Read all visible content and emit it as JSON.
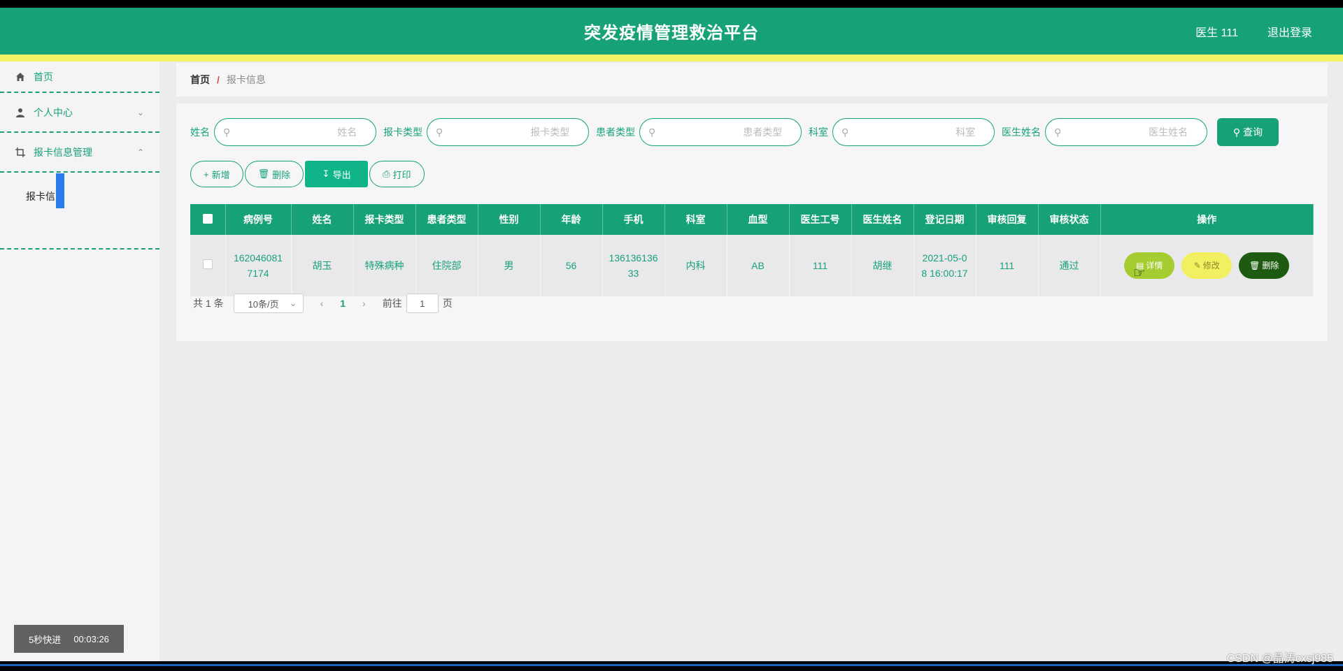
{
  "header": {
    "title": "突发疫情管理救治平台",
    "user": "医生 111",
    "logout": "退出登录"
  },
  "sidebar": {
    "items": [
      {
        "label": "首页",
        "icon": "home-icon"
      },
      {
        "label": "个人中心",
        "icon": "user-icon"
      },
      {
        "label": "报卡信息管理",
        "icon": "crop-icon"
      }
    ],
    "sub_item": "报卡信息"
  },
  "breadcrumb": {
    "home": "首页",
    "sep": "/",
    "current": "报卡信息"
  },
  "search": {
    "fields": [
      {
        "label": "姓名",
        "placeholder": "姓名"
      },
      {
        "label": "报卡类型",
        "placeholder": "报卡类型"
      },
      {
        "label": "患者类型",
        "placeholder": "患者类型"
      },
      {
        "label": "科室",
        "placeholder": "科室"
      },
      {
        "label": "医生姓名",
        "placeholder": "医生姓名"
      }
    ],
    "query_label": "查询"
  },
  "actions": {
    "add": "新增",
    "delete": "删除",
    "export": "导出",
    "print": "打印"
  },
  "table": {
    "headers": [
      "病例号",
      "姓名",
      "报卡类型",
      "患者类型",
      "性别",
      "年龄",
      "手机",
      "科室",
      "血型",
      "医生工号",
      "医生姓名",
      "登记日期",
      "审核回复",
      "审核状态",
      "操作"
    ],
    "rows": [
      {
        "case_no": "1620460817174",
        "name": "胡玉",
        "card_type": "特殊病种",
        "patient_type": "住院部",
        "gender": "男",
        "age": "56",
        "phone": "13613613633",
        "dept": "内科",
        "blood": "AB",
        "doctor_id": "111",
        "doctor_name": "胡继",
        "date": "2021-05-08 16:00:17",
        "reply": "111",
        "status": "通过"
      }
    ],
    "ops": {
      "detail": "详情",
      "edit": "修改",
      "delete": "删除"
    }
  },
  "pager": {
    "total": "共 1 条",
    "size": "10条/页",
    "page": "1",
    "goto_prefix": "前往",
    "goto_value": "1",
    "goto_suffix": "页"
  },
  "overlay": {
    "ff_label": "5秒快进",
    "time": "00:03:26",
    "watermark": "CSDN @晶涛cxsj985"
  }
}
